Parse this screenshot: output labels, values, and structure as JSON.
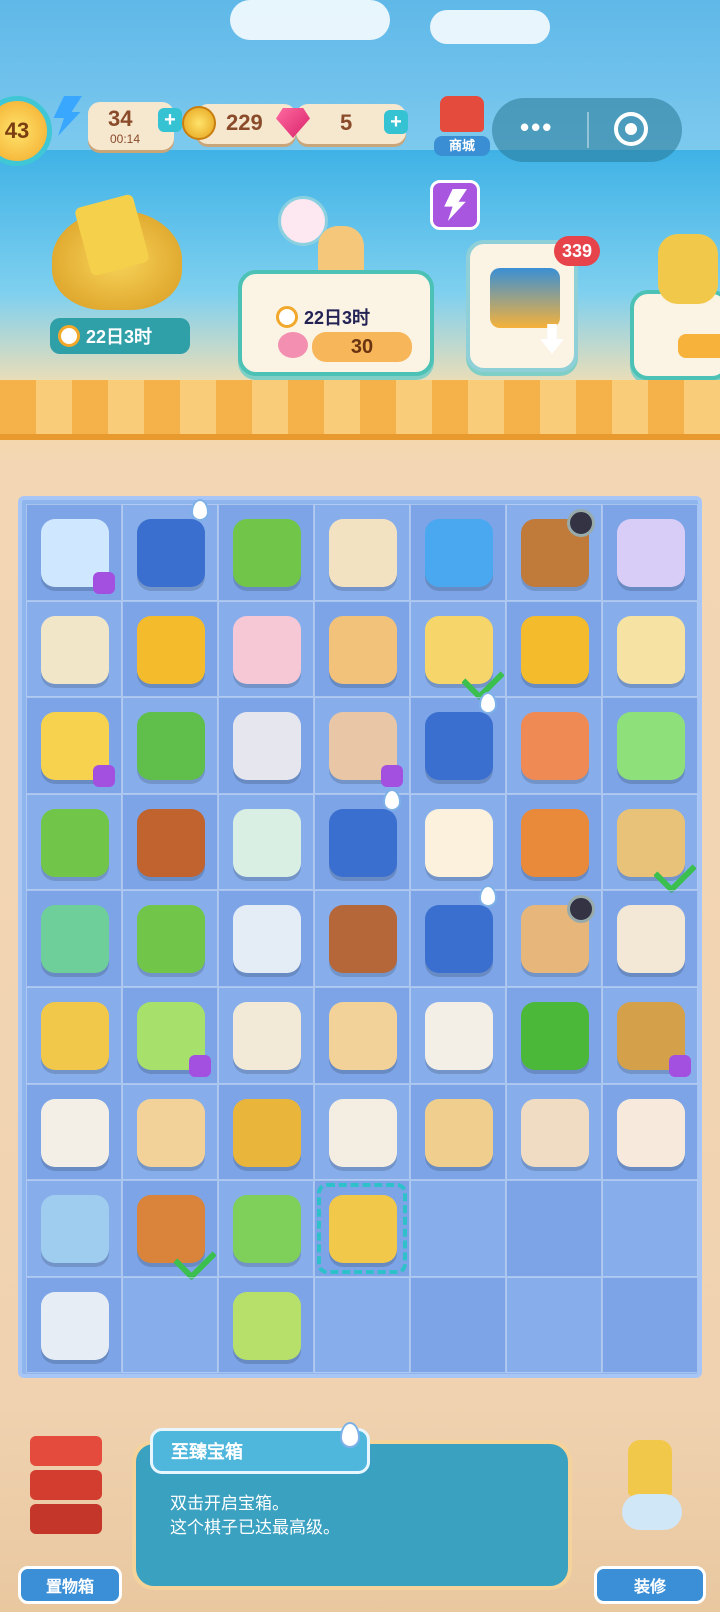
{
  "hud": {
    "level": "43",
    "energy_value": "34",
    "energy_timer": "00:14",
    "coins": "229",
    "gems": "5",
    "shop_label": "商城",
    "capsule_more": "•••"
  },
  "events": {
    "bag_timer": "22日3时",
    "kid_timer": "22日3时",
    "kid_progress": "30",
    "chest_count": "339"
  },
  "board": {
    "cells": [
      {
        "icon": "goldfish-bag",
        "color": "#cfe7ff",
        "badge": "energy"
      },
      {
        "icon": "treasure-pouch",
        "color": "#3a6fd0",
        "badge": "drop"
      },
      {
        "icon": "juicer-cup",
        "color": "#71c64a",
        "badge": ""
      },
      {
        "icon": "steamed-bun-roll",
        "color": "#f3e2c1",
        "badge": ""
      },
      {
        "icon": "mini-fridge",
        "color": "#4aa8f0",
        "badge": ""
      },
      {
        "icon": "cherry-basket",
        "color": "#c07a3a",
        "badge": "timer"
      },
      {
        "icon": "crystal-shard",
        "color": "#d8cdf7",
        "badge": ""
      },
      {
        "icon": "fishing-net",
        "color": "#f1e6c8",
        "badge": ""
      },
      {
        "icon": "gold-coins-pile",
        "color": "#f4bb2c",
        "badge": ""
      },
      {
        "icon": "ice-cream-cone",
        "color": "#f6c8d6",
        "badge": ""
      },
      {
        "icon": "fried-shrimp-plate",
        "color": "#f2c27a",
        "badge": ""
      },
      {
        "icon": "corn-soup-bowl",
        "color": "#f6d66a",
        "badge": "check"
      },
      {
        "icon": "gold-coins-small",
        "color": "#f4bb2c",
        "badge": ""
      },
      {
        "icon": "tofu-block",
        "color": "#f6e2a3",
        "badge": ""
      },
      {
        "icon": "water-bucket",
        "color": "#f6d24e",
        "badge": "energy"
      },
      {
        "icon": "bok-choy",
        "color": "#5fbf4a",
        "badge": ""
      },
      {
        "icon": "bento-box",
        "color": "#e6e6ef",
        "badge": ""
      },
      {
        "icon": "paper-bag",
        "color": "#e9c7a6",
        "badge": "energy"
      },
      {
        "icon": "coin-pouch",
        "color": "#3a6fd0",
        "badge": "drop"
      },
      {
        "icon": "peach",
        "color": "#f08a55",
        "badge": ""
      },
      {
        "icon": "pepper-bubble",
        "color": "#8ee07a",
        "badge": ""
      },
      {
        "icon": "juicer-cup",
        "color": "#71c64a",
        "badge": ""
      },
      {
        "icon": "roast-chicken-plate",
        "color": "#c0632f",
        "badge": ""
      },
      {
        "icon": "sake-bottle",
        "color": "#d9efe3",
        "badge": ""
      },
      {
        "icon": "treasure-pouch",
        "color": "#3a6fd0",
        "badge": "drop"
      },
      {
        "icon": "soft-serve-cone",
        "color": "#fbf1dc",
        "badge": ""
      },
      {
        "icon": "fish-dish",
        "color": "#e98a3a",
        "badge": ""
      },
      {
        "icon": "burrito-wrap",
        "color": "#e9c27a",
        "badge": "check"
      },
      {
        "icon": "dumpling-bowl",
        "color": "#6fcf9a",
        "badge": ""
      },
      {
        "icon": "juicer-cup",
        "color": "#71c64a",
        "badge": ""
      },
      {
        "icon": "teapot",
        "color": "#e4edf6",
        "badge": ""
      },
      {
        "icon": "lemon-tea-cup",
        "color": "#b5673a",
        "badge": ""
      },
      {
        "icon": "treasure-heap",
        "color": "#3a6fd0",
        "badge": "drop"
      },
      {
        "icon": "clay-pot",
        "color": "#e6b67a",
        "badge": "timer"
      },
      {
        "icon": "flour-bowl",
        "color": "#f3e7d6",
        "badge": ""
      },
      {
        "icon": "rolling-pin",
        "color": "#f2c84a",
        "badge": ""
      },
      {
        "icon": "blender",
        "color": "#a7e06a",
        "badge": "energy"
      },
      {
        "icon": "strainer",
        "color": "#f2ead7",
        "badge": ""
      },
      {
        "icon": "fried-rice-tray",
        "color": "#f3d29a",
        "badge": ""
      },
      {
        "icon": "covered-bowl",
        "color": "#f4efe6",
        "badge": ""
      },
      {
        "icon": "green-pepper",
        "color": "#4cb83a",
        "badge": ""
      },
      {
        "icon": "corn-basket",
        "color": "#d4a04a",
        "badge": "energy"
      },
      {
        "icon": "egg-custard-bowl",
        "color": "#f4efe6",
        "badge": ""
      },
      {
        "icon": "fried-rice-tray",
        "color": "#f3d29a",
        "badge": ""
      },
      {
        "icon": "honey-jar",
        "color": "#e9b53a",
        "badge": ""
      },
      {
        "icon": "takeout-box",
        "color": "#f3ede2",
        "badge": ""
      },
      {
        "icon": "taco-plate",
        "color": "#f0cf8e",
        "badge": ""
      },
      {
        "icon": "bread-bun",
        "color": "#f0dcc2",
        "badge": ""
      },
      {
        "icon": "egg-bowl",
        "color": "#f7eadd",
        "badge": ""
      },
      {
        "icon": "flower-bowl",
        "color": "#9fcdf0",
        "badge": ""
      },
      {
        "icon": "roast-duck-plate",
        "color": "#d9843a",
        "badge": "check"
      },
      {
        "icon": "cabbage",
        "color": "#7ed05a",
        "badge": ""
      },
      {
        "icon": "supreme-chest",
        "color": "#f2c84a",
        "badge": "selected"
      },
      {
        "icon": "",
        "color": "",
        "badge": ""
      },
      {
        "icon": "",
        "color": "",
        "badge": ""
      },
      {
        "icon": "",
        "color": "",
        "badge": ""
      },
      {
        "icon": "flower-bowl",
        "color": "#e6edf5",
        "badge": ""
      },
      {
        "icon": "",
        "color": "",
        "badge": ""
      },
      {
        "icon": "corn-bubble",
        "color": "#b7e06a",
        "badge": ""
      },
      {
        "icon": "",
        "color": "",
        "badge": ""
      },
      {
        "icon": "",
        "color": "",
        "badge": ""
      },
      {
        "icon": "",
        "color": "",
        "badge": ""
      },
      {
        "icon": "",
        "color": "",
        "badge": ""
      }
    ]
  },
  "info": {
    "title": "至臻宝箱",
    "line1": "双击开启宝箱。",
    "line2": "这个棋子已达最高级。"
  },
  "bottom": {
    "storage_label": "置物箱",
    "decorate_label": "装修"
  }
}
